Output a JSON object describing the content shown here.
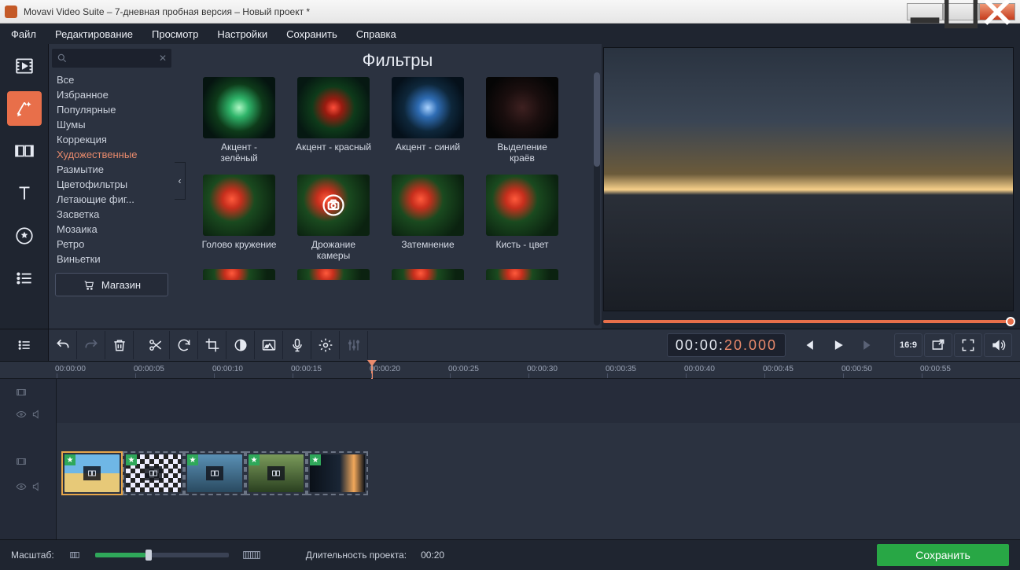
{
  "window": {
    "title": "Movavi Video Suite – 7-дневная пробная версия – Новый проект *"
  },
  "menu": {
    "file": "Файл",
    "edit": "Редактирование",
    "view": "Просмотр",
    "settings": "Настройки",
    "save": "Сохранить",
    "help": "Справка"
  },
  "filters": {
    "title": "Фильтры",
    "search_placeholder": "",
    "categories": [
      "Все",
      "Избранное",
      "Популярные",
      "Шумы",
      "Коррекция",
      "Художественные",
      "Размытие",
      "Цветофильтры",
      "Летающие фиг...",
      "Засветка",
      "Мозаика",
      "Ретро",
      "Виньетки"
    ],
    "selected_category_index": 5,
    "shop": "Магазин",
    "items": [
      {
        "label": "Акцент - зелёный"
      },
      {
        "label": "Акцент - красный"
      },
      {
        "label": "Акцент - синий"
      },
      {
        "label": "Выделение краёв"
      },
      {
        "label": "Голово кружение"
      },
      {
        "label": "Дрожание камеры"
      },
      {
        "label": "Затемнение"
      },
      {
        "label": "Кисть - цвет"
      }
    ]
  },
  "timecode": {
    "white": "00:00:",
    "orange": "20.000"
  },
  "aspect": "16:9",
  "ruler": {
    "ticks": [
      "00:00:00",
      "00:00:05",
      "00:00:10",
      "00:00:15",
      "00:00:20",
      "00:00:25",
      "00:00:30",
      "00:00:35",
      "00:00:40",
      "00:00:45",
      "00:00:50",
      "00:00:55"
    ]
  },
  "bottom": {
    "zoom_label": "Масштаб:",
    "duration_label": "Длительность проекта:",
    "duration_value": "00:20",
    "save": "Сохранить"
  }
}
